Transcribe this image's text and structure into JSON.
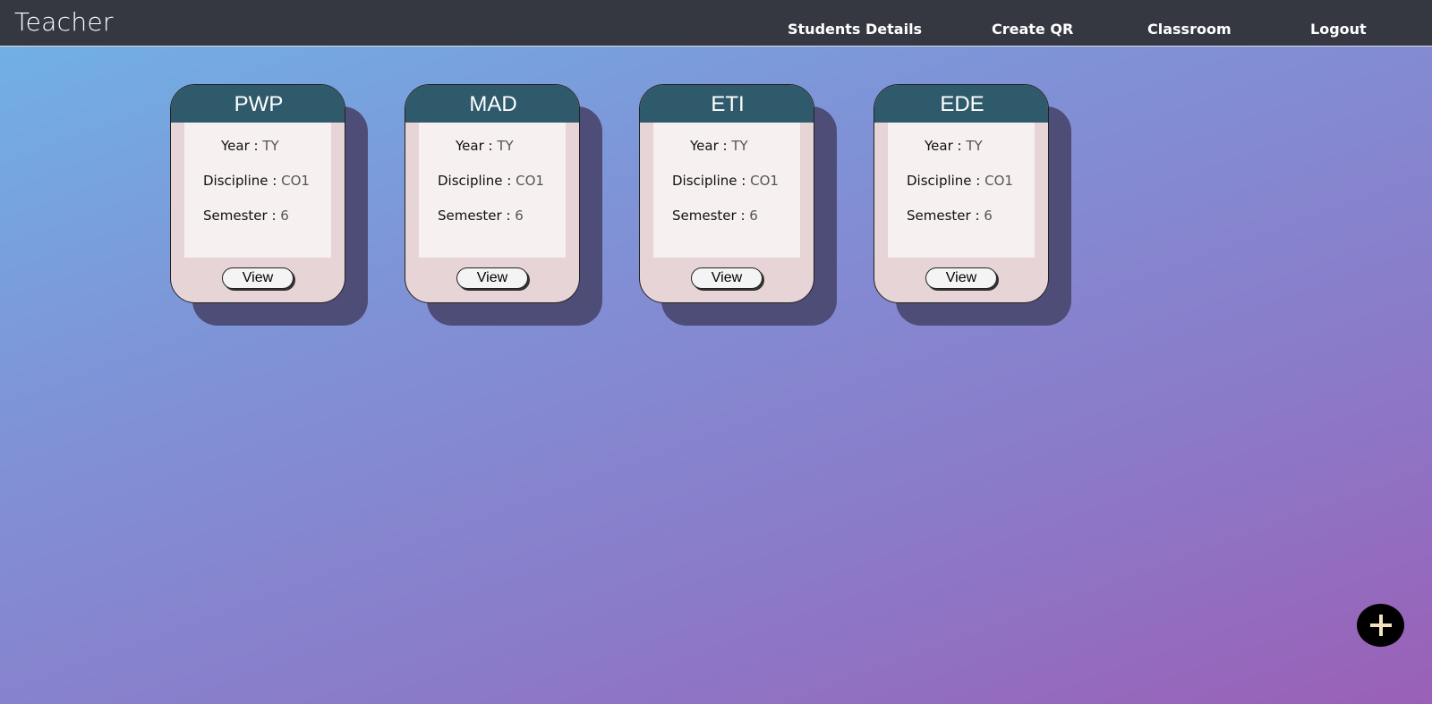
{
  "header": {
    "brand": "Teacher",
    "nav": [
      {
        "label": "Students Details"
      },
      {
        "label": "Create QR"
      },
      {
        "label": "Classroom"
      },
      {
        "label": "Logout"
      }
    ]
  },
  "cards": [
    {
      "title": "PWP",
      "year_label": "Year :",
      "year": "TY",
      "discipline_label": "Discipline :",
      "discipline": "CO1",
      "semester_label": "Semester :",
      "semester": "6",
      "button": "View"
    },
    {
      "title": "MAD",
      "year_label": "Year :",
      "year": "TY",
      "discipline_label": "Discipline :",
      "discipline": "CO1",
      "semester_label": "Semester :",
      "semester": "6",
      "button": "View"
    },
    {
      "title": "ETI",
      "year_label": "Year :",
      "year": "TY",
      "discipline_label": "Discipline :",
      "discipline": "CO1",
      "semester_label": "Semester :",
      "semester": "6",
      "button": "View"
    },
    {
      "title": "EDE",
      "year_label": "Year :",
      "year": "TY",
      "discipline_label": "Discipline :",
      "discipline": "CO1",
      "semester_label": "Semester :",
      "semester": "6",
      "button": "View"
    }
  ],
  "fab": {
    "icon": "plus-icon"
  },
  "colors": {
    "topbar": "#353841",
    "card_header": "#2f5a6b",
    "card_bg": "#e6d4d6",
    "card_body": "#f6f0f0",
    "card_shadow": "#4d4d78",
    "fab_plus": "#f3e2bd"
  }
}
